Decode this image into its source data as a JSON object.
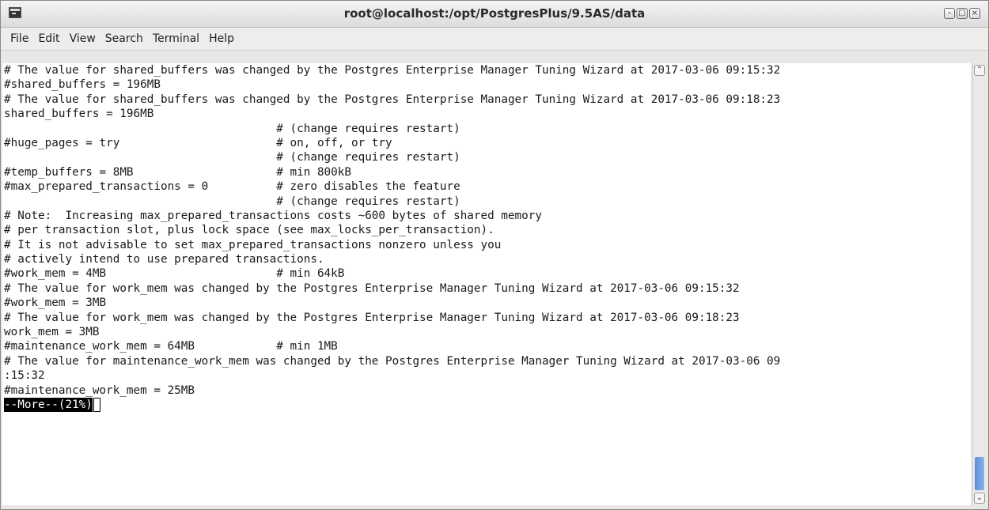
{
  "window": {
    "title": "root@localhost:/opt/PostgresPlus/9.5AS/data",
    "controls": {
      "minimize": "–",
      "maximize": "□",
      "close": "×"
    }
  },
  "menu": [
    "File",
    "Edit",
    "View",
    "Search",
    "Terminal",
    "Help"
  ],
  "terminal": {
    "lines": [
      "# The value for shared_buffers was changed by the Postgres Enterprise Manager Tuning Wizard at 2017-03-06 09:15:32",
      "#shared_buffers = 196MB",
      "# The value for shared_buffers was changed by the Postgres Enterprise Manager Tuning Wizard at 2017-03-06 09:18:23",
      "shared_buffers = 196MB",
      "                                        # (change requires restart)",
      "#huge_pages = try                       # on, off, or try",
      "                                        # (change requires restart)",
      "#temp_buffers = 8MB                     # min 800kB",
      "#max_prepared_transactions = 0          # zero disables the feature",
      "                                        # (change requires restart)",
      "# Note:  Increasing max_prepared_transactions costs ~600 bytes of shared memory",
      "# per transaction slot, plus lock space (see max_locks_per_transaction).",
      "# It is not advisable to set max_prepared_transactions nonzero unless you",
      "# actively intend to use prepared transactions.",
      "#work_mem = 4MB                         # min 64kB",
      "# The value for work_mem was changed by the Postgres Enterprise Manager Tuning Wizard at 2017-03-06 09:15:32",
      "#work_mem = 3MB",
      "# The value for work_mem was changed by the Postgres Enterprise Manager Tuning Wizard at 2017-03-06 09:18:23",
      "work_mem = 3MB",
      "#maintenance_work_mem = 64MB            # min 1MB",
      "# The value for maintenance_work_mem was changed by the Postgres Enterprise Manager Tuning Wizard at 2017-03-06 09",
      ":15:32",
      "#maintenance_work_mem = 25MB"
    ],
    "more_prompt": "--More--(21%)"
  },
  "scrollbar": {
    "up": "⌃",
    "down": "⌄",
    "position_percent": 92
  }
}
